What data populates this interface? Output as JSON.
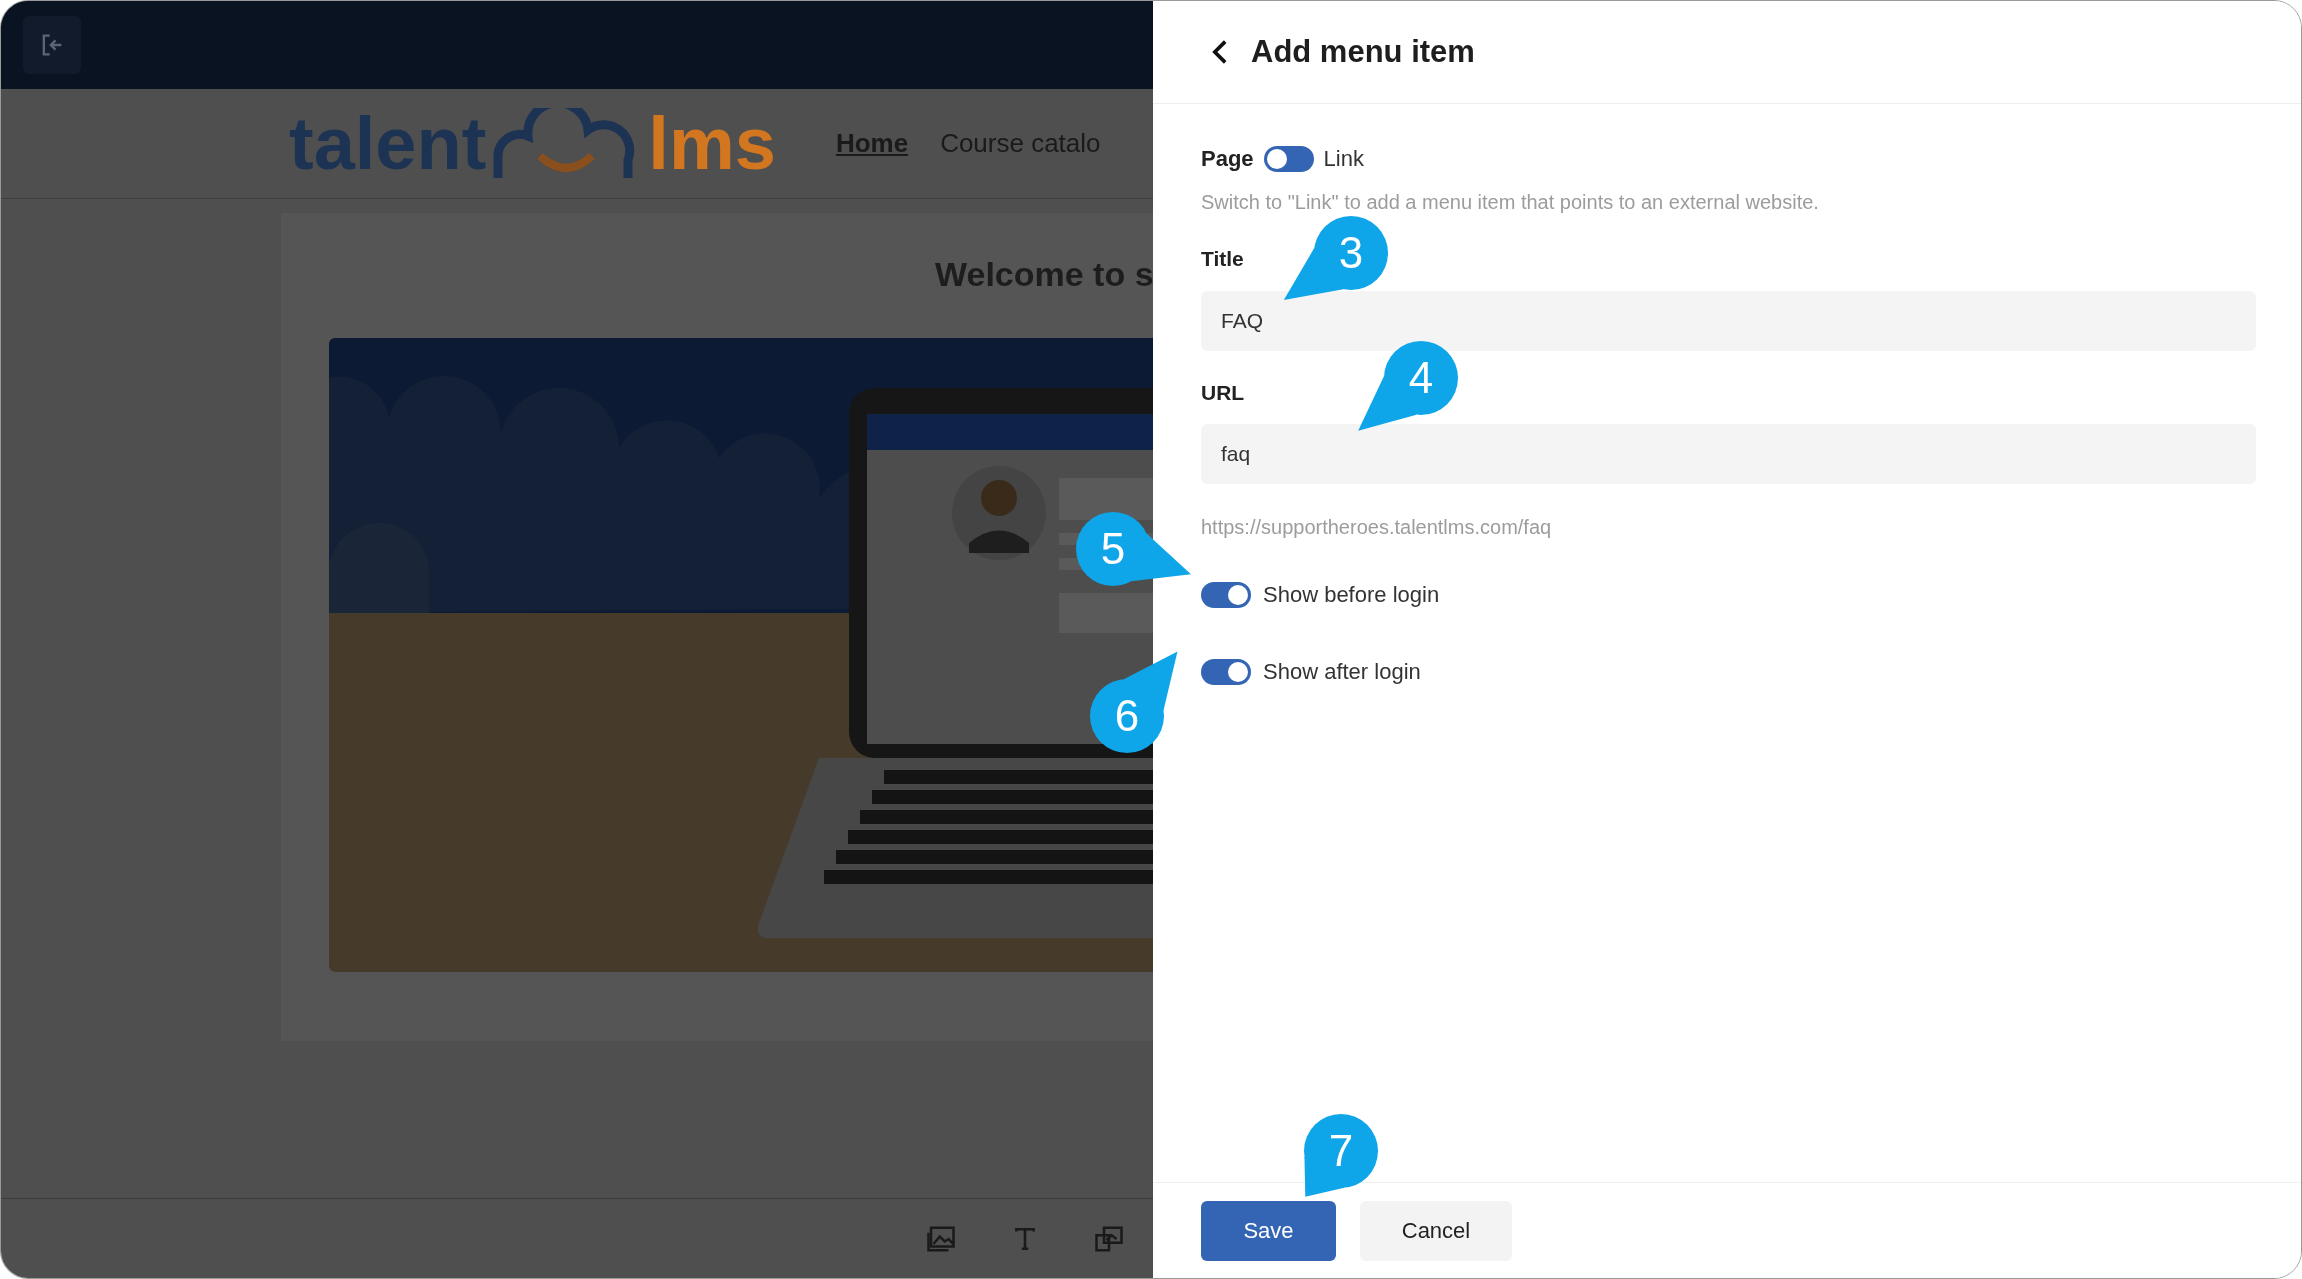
{
  "site": {
    "logo": {
      "left": "talent",
      "right": "lms"
    },
    "nav": [
      {
        "label": "Home",
        "selected": true
      },
      {
        "label": "Course catalo",
        "selected": false
      }
    ],
    "heading": "Welcome to s"
  },
  "panel": {
    "title": "Add menu item",
    "mode_switch": {
      "left_label": "Page",
      "right_label": "Link",
      "link_selected": false
    },
    "hint": "Switch to \"Link\" to add a menu item that points to an external website.",
    "fields": [
      {
        "label": "Title",
        "value": "FAQ"
      },
      {
        "label": "URL",
        "value": "faq"
      }
    ],
    "url_preview": "https://supportheroes.talentlms.com/faq",
    "toggles": [
      {
        "label": "Show before login",
        "on": true
      },
      {
        "label": "Show after login",
        "on": true
      }
    ],
    "buttons": [
      {
        "label": "Save",
        "kind": "primary"
      },
      {
        "label": "Cancel",
        "kind": "secondary"
      }
    ]
  },
  "callouts": [
    {
      "label": "3"
    },
    {
      "label": "4"
    },
    {
      "label": "5"
    },
    {
      "label": "6"
    },
    {
      "label": "7"
    }
  ]
}
